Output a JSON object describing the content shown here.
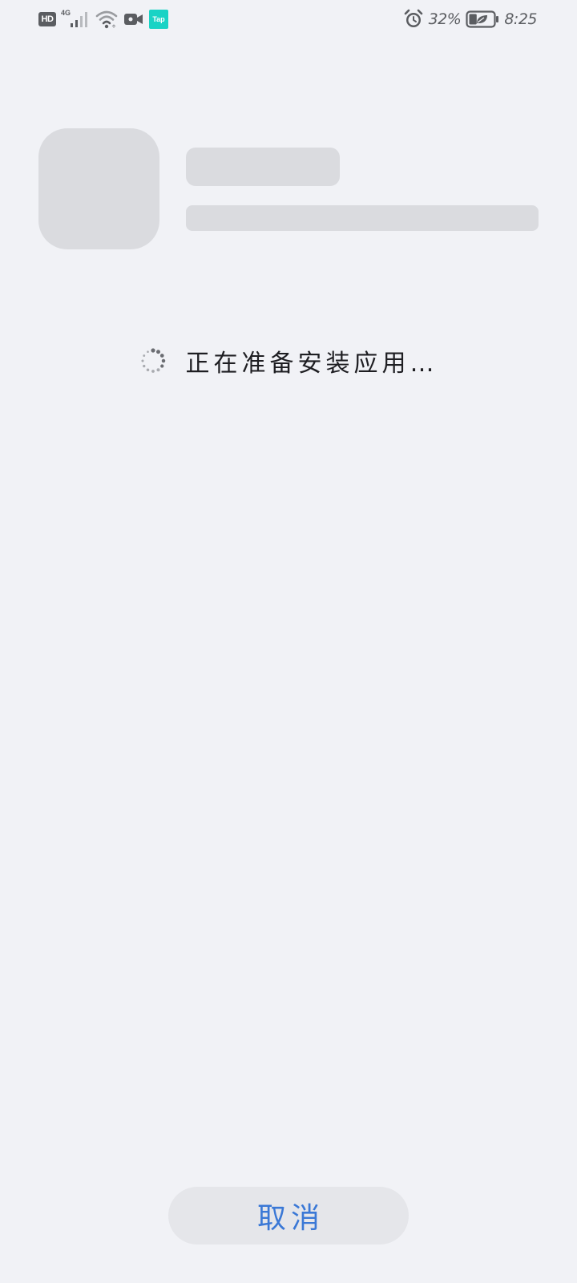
{
  "status_bar": {
    "hd_label": "HD",
    "network_type": "4G",
    "tap_label": "Tap",
    "battery_percent": "32%",
    "battery_level": 0.32,
    "time": "8:25",
    "icons": [
      "hd-icon",
      "cellular-signal-icon",
      "wifi-icon",
      "video-camera-icon",
      "taptap-app-icon",
      "alarm-icon",
      "battery-saver-icon"
    ]
  },
  "install": {
    "status_message": "正在准备安装应用…",
    "cancel_label": "取消"
  },
  "colors": {
    "background": "#f1f2f6",
    "placeholder": "#dadbdf",
    "button_bg": "#e5e6ea",
    "accent": "#3a78d6",
    "tap_brand": "#19d3c5"
  }
}
